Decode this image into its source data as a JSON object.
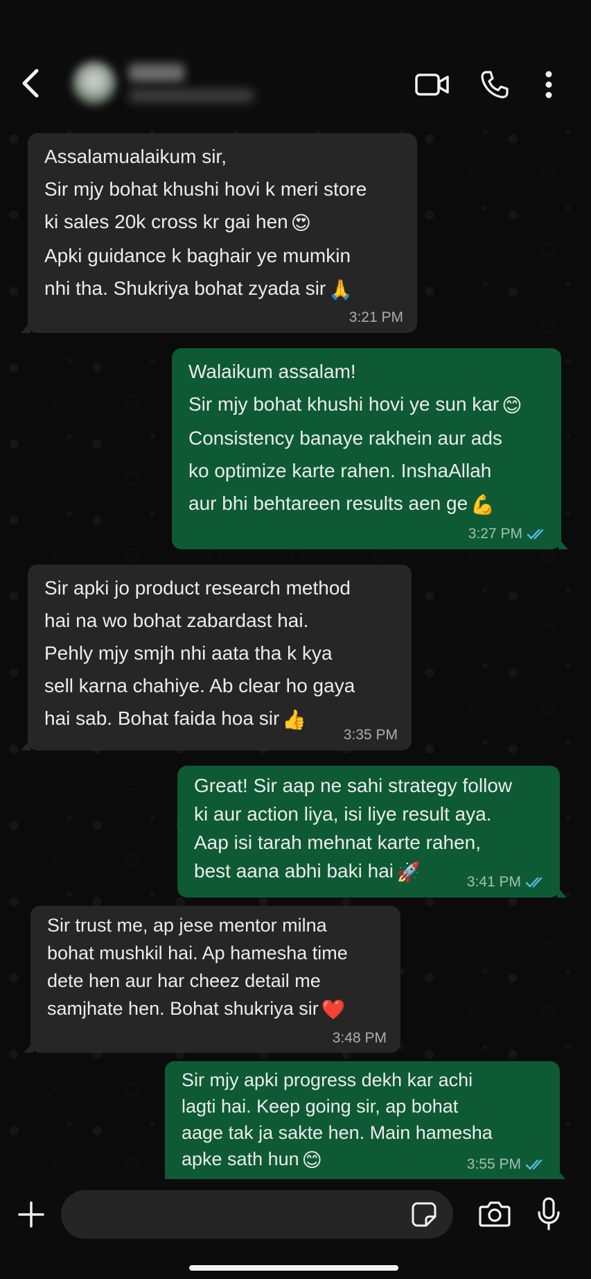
{
  "header": {
    "contact_name": "",
    "contact_status": "",
    "icons": {
      "back": "chevron-left-icon",
      "video": "video-camera-icon",
      "call": "phone-icon",
      "menu": "more-vertical-icon"
    }
  },
  "messages": [
    {
      "direction": "incoming",
      "lines": [
        "Assalamualaikum sir,",
        "Sir mjy bohat khushi hovi k meri store",
        "ki sales 20k cross kr gai hen",
        "Apki guidance k baghair ye mumkin",
        "nhi tha. Shukriya bohat zyada sir"
      ],
      "emojis": [
        "",
        "",
        "😍",
        "",
        "🙏"
      ],
      "time": "3:21 PM"
    },
    {
      "direction": "outgoing",
      "lines": [
        "Walaikum assalam!",
        "Sir mjy bohat khushi hovi ye sun kar",
        "Consistency banaye rakhein aur ads",
        "ko optimize karte rahen. InshaAllah",
        "aur bhi behtareen results aen ge"
      ],
      "emojis": [
        "",
        "😊",
        "",
        "",
        "💪"
      ],
      "time": "3:27 PM",
      "status": "read"
    },
    {
      "direction": "incoming",
      "lines": [
        "Sir apki jo product research method",
        "hai na wo bohat zabardast hai.",
        "Pehly mjy smjh nhi aata tha k kya",
        "sell karna chahiye. Ab clear ho gaya",
        "hai sab. Bohat faida hoa sir"
      ],
      "emojis": [
        "",
        "",
        "",
        "",
        "👍"
      ],
      "time": "3:35 PM"
    },
    {
      "direction": "outgoing",
      "lines": [
        "Great! Sir aap ne sahi strategy follow",
        "ki aur action liya, isi liye result aya.",
        "Aap isi tarah mehnat karte rahen,",
        "best aana abhi baki hai"
      ],
      "emojis": [
        "",
        "",
        "",
        "🚀"
      ],
      "time": "3:41 PM",
      "status": "read"
    },
    {
      "direction": "incoming",
      "lines": [
        "Sir trust me, ap jese mentor milna",
        "bohat mushkil hai. Ap hamesha time",
        "dete hen aur har cheez detail me",
        "samjhate hen. Bohat shukriya sir"
      ],
      "emojis": [
        "",
        "",
        "",
        "❤️"
      ],
      "time": "3:48 PM"
    },
    {
      "direction": "outgoing",
      "lines": [
        "Sir mjy apki progress dekh kar achi",
        "lagti hai. Keep going sir, ap bohat",
        "aage tak ja sakte hen. Main hamesha",
        "apke sath hun"
      ],
      "emojis": [
        "",
        "",
        "",
        "😊"
      ],
      "time": "3:55 PM",
      "status": "read"
    }
  ],
  "composer": {
    "placeholder": "",
    "value": "",
    "icons": {
      "attach": "plus-icon",
      "sticker": "sticker-icon",
      "camera": "camera-icon",
      "mic": "microphone-icon"
    }
  },
  "colors": {
    "background": "#0b0b0b",
    "incoming_bubble": "#262626",
    "outgoing_bubble": "#0e5a35",
    "read_ticks": "#53bdeb"
  }
}
